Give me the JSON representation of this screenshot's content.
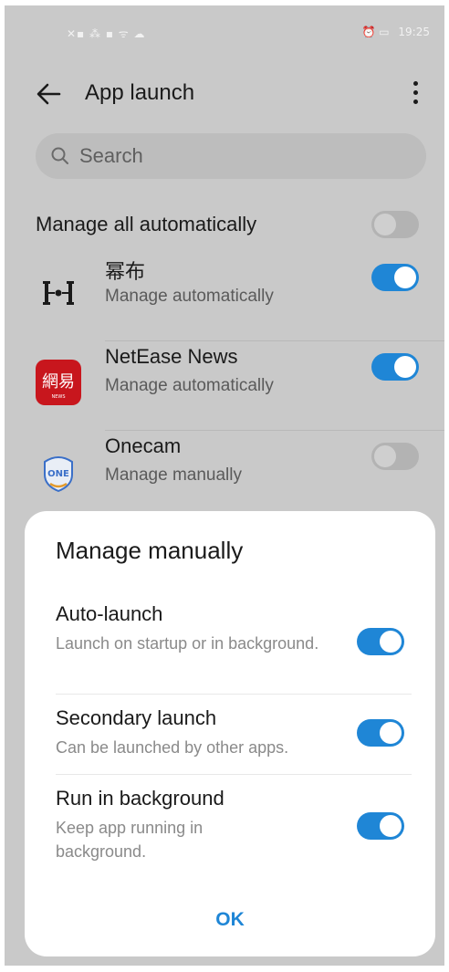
{
  "status_bar": {
    "left_icons": "✕▪ ⁂ ▪ ᯤ ☁",
    "right_icons": "⏰ ▭",
    "time": "19:25"
  },
  "header": {
    "title": "App launch",
    "back_icon": "arrow-left-icon",
    "more_icon": "more-vertical-icon"
  },
  "search": {
    "placeholder": "Search"
  },
  "manage_all": {
    "label": "Manage all automatically",
    "enabled": false
  },
  "apps": [
    {
      "name": "幂布",
      "status": "Manage automatically",
      "enabled": true,
      "icon": "mubu-app-icon"
    },
    {
      "name": "NetEase News",
      "status": "Manage automatically",
      "enabled": true,
      "icon": "netease-news-app-icon"
    },
    {
      "name": "Onecam",
      "status": "Manage manually",
      "enabled": false,
      "icon": "onecam-app-icon"
    }
  ],
  "dialog": {
    "title": "Manage manually",
    "options": [
      {
        "title": "Auto-launch",
        "desc": "Launch on startup or in background.",
        "enabled": true
      },
      {
        "title": "Secondary launch",
        "desc": "Can be launched by other apps.",
        "enabled": true
      },
      {
        "title": "Run in background",
        "desc": "Keep app running in background.",
        "enabled": true
      }
    ],
    "ok_label": "OK"
  },
  "colors": {
    "accent": "#1f86d6",
    "scrim": "#c9c9c9",
    "netease_red": "#c8161d"
  }
}
